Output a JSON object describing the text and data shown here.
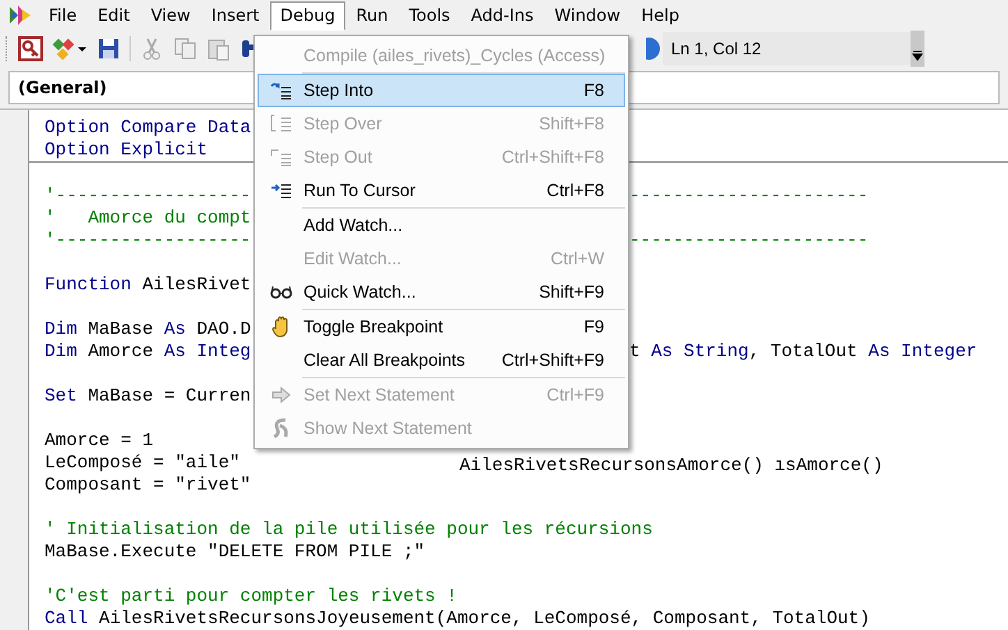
{
  "menubar": [
    {
      "label": "File",
      "selected": false
    },
    {
      "label": "Edit",
      "selected": false
    },
    {
      "label": "View",
      "selected": false
    },
    {
      "label": "Insert",
      "selected": false
    },
    {
      "label": "Debug",
      "selected": true
    },
    {
      "label": "Run",
      "selected": false
    },
    {
      "label": "Tools",
      "selected": false
    },
    {
      "label": "Add-Ins",
      "selected": false
    },
    {
      "label": "Window",
      "selected": false
    },
    {
      "label": "Help",
      "selected": false
    }
  ],
  "toolbar": {
    "position": "Ln 1, Col 12"
  },
  "object_combo": {
    "value": "(General)"
  },
  "code": [
    {
      "kind": "code",
      "left": [
        {
          "kind": "kw",
          "text": "Option Compare Data"
        }
      ]
    },
    {
      "kind": "code",
      "left": [
        {
          "kind": "kw",
          "text": "Option Explicit"
        }
      ],
      "divider": true
    },
    {
      "kind": "blank"
    },
    {
      "kind": "code",
      "left": [
        {
          "kind": "cmt",
          "text": "'------------------"
        }
      ],
      "right": [
        {
          "kind": "cmt",
          "text": "----------------------"
        }
      ]
    },
    {
      "kind": "code",
      "left": [
        {
          "kind": "cmt",
          "text": "'   Amorce du compt"
        }
      ]
    },
    {
      "kind": "code",
      "left": [
        {
          "kind": "cmt",
          "text": "'------------------"
        }
      ],
      "right": [
        {
          "kind": "cmt",
          "text": "----------------------"
        }
      ]
    },
    {
      "kind": "blank"
    },
    {
      "kind": "code",
      "left": [
        {
          "kind": "kw",
          "text": "Function"
        },
        {
          "kind": "txt",
          "text": " AilesRivet"
        }
      ]
    },
    {
      "kind": "blank"
    },
    {
      "kind": "code",
      "left": [
        {
          "kind": "kw",
          "text": "Dim"
        },
        {
          "kind": "txt",
          "text": " MaBase "
        },
        {
          "kind": "kw",
          "text": "As"
        },
        {
          "kind": "txt",
          "text": " DAO.D"
        }
      ]
    },
    {
      "kind": "code",
      "left": [
        {
          "kind": "kw",
          "text": "Dim"
        },
        {
          "kind": "txt",
          "text": " Amorce "
        },
        {
          "kind": "kw",
          "text": "As Integ"
        }
      ],
      "right": [
        {
          "kind": "txt",
          "text": "t "
        },
        {
          "kind": "kw",
          "text": "As String"
        },
        {
          "kind": "txt",
          "text": ", TotalOut "
        },
        {
          "kind": "kw",
          "text": "As Integer"
        }
      ]
    },
    {
      "kind": "blank"
    },
    {
      "kind": "code",
      "left": [
        {
          "kind": "kw",
          "text": "Set"
        },
        {
          "kind": "txt",
          "text": " MaBase = Curren"
        }
      ]
    },
    {
      "kind": "blank"
    },
    {
      "kind": "code",
      "left": [
        {
          "kind": "txt",
          "text": "Amorce = 1"
        }
      ]
    },
    {
      "kind": "code",
      "left": [
        {
          "kind": "txt",
          "text": "LeComposé = \"aile\""
        }
      ],
      "ghost": "AilesRivetsRecursonsAmorce() ısAmorce()"
    },
    {
      "kind": "code",
      "left": [
        {
          "kind": "txt",
          "text": "Composant = \"rivet\""
        }
      ]
    },
    {
      "kind": "blank"
    },
    {
      "kind": "code",
      "left": [
        {
          "kind": "cmt",
          "text": "' Initialisation de la pile utilisée pour les récursions"
        }
      ]
    },
    {
      "kind": "code",
      "left": [
        {
          "kind": "txt",
          "text": "MaBase.Execute \"DELETE FROM PILE ;\""
        }
      ]
    },
    {
      "kind": "blank"
    },
    {
      "kind": "code",
      "left": [
        {
          "kind": "cmt",
          "text": "'C'est parti pour compter les rivets !"
        }
      ]
    },
    {
      "kind": "code",
      "left": [
        {
          "kind": "kw",
          "text": "Call"
        },
        {
          "kind": "txt",
          "text": " AilesRivetsRecursonsJoyeusement(Amorce, LeComposé, Composant, TotalOut)"
        }
      ]
    }
  ],
  "debug_menu": [
    [
      {
        "label": "Compile (ailes_rivets)_Cycles (Access)",
        "disabled": true,
        "selected": false
      }
    ],
    [
      {
        "label": "Step Into",
        "shortcut": "F8",
        "disabled": false,
        "selected": true
      },
      {
        "label": "Step Over",
        "shortcut": "Shift+F8",
        "disabled": true,
        "selected": false
      },
      {
        "label": "Step Out",
        "shortcut": "Ctrl+Shift+F8",
        "disabled": true,
        "selected": false
      },
      {
        "label": "Run To Cursor",
        "shortcut": "Ctrl+F8",
        "disabled": false,
        "selected": false
      }
    ],
    [
      {
        "label": "Add Watch...",
        "disabled": false,
        "selected": false
      },
      {
        "label": "Edit Watch...",
        "shortcut": "Ctrl+W",
        "disabled": true,
        "selected": false
      },
      {
        "label": "Quick Watch...",
        "shortcut": "Shift+F9",
        "disabled": false,
        "selected": false
      }
    ],
    [
      {
        "label": "Toggle Breakpoint",
        "shortcut": "F9",
        "disabled": false,
        "selected": false
      },
      {
        "label": "Clear All Breakpoints",
        "shortcut": "Ctrl+Shift+F9",
        "disabled": false,
        "selected": false
      }
    ],
    [
      {
        "label": "Set Next Statement",
        "shortcut": "Ctrl+F9",
        "disabled": true,
        "selected": false
      },
      {
        "label": "Show Next Statement",
        "disabled": true,
        "selected": false
      }
    ]
  ]
}
